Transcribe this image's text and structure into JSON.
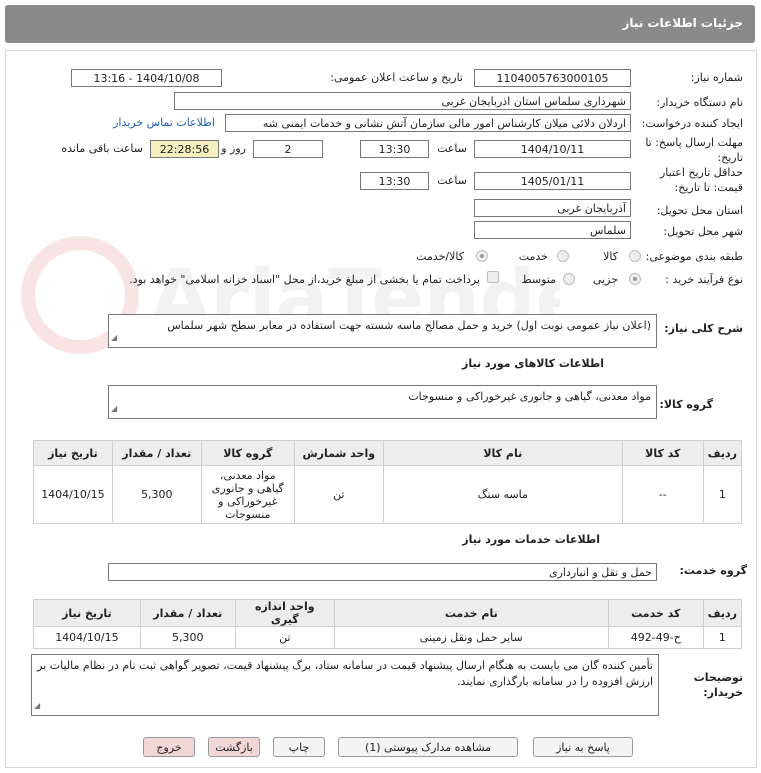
{
  "header": {
    "title": "جزئیات اطلاعات نیاز"
  },
  "watermark": {
    "text": "AriaTender.neT"
  },
  "form": {
    "need_number_label": "شماره نیاز:",
    "need_number": "1104005763000105",
    "announce_label": "تاریخ و ساعت اعلان عمومی:",
    "announce_value": "1404/10/08 - 13:16",
    "buyer_label": "نام دستگاه خریدار:",
    "buyer_value": "شهرداری سلماس استان اذربایجان غربی",
    "requester_label": "ایجاد کننده درخواست:",
    "requester_value": "اردلان دلائی میلان کارشناس امور مالی سازمان آتش نشانی و خدمات ایمنی شه",
    "contact_link": "اطلاعات تماس خریدار",
    "deadline_label_1": "مهلت ارسال پاسخ: تا",
    "deadline_label_2": "تاریخ:",
    "deadline_date": "1404/10/11",
    "time_label": "ساعت",
    "deadline_time": "13:30",
    "days_value": "2",
    "days_label": "روز و",
    "remaining_value": "22:28:56",
    "remaining_label": "ساعت باقی مانده",
    "validity_label_1": "حداقل تاریخ اعتبار",
    "validity_label_2": "قیمت: تا تاریخ:",
    "validity_date": "1405/01/11",
    "validity_time": "13:30",
    "province_label": "استان محل تحویل:",
    "province_value": "آذربایجان غربی",
    "city_label": "شهر محل تحویل:",
    "city_value": "سلماس",
    "category_label": "طبقه بندی موضوعی:",
    "category_options": [
      "کالا",
      "خدمت",
      "کالا/خدمت"
    ],
    "category_selected": "کالا/خدمت",
    "process_label": "نوع فرآیند خرید :",
    "process_options": [
      "جزیی",
      "متوسط"
    ],
    "process_selected": "جزیی",
    "payment_note": "پرداخت تمام یا بخشی از مبلغ خرید،از محل \"اسناد خزانه اسلامی\" خواهد بود."
  },
  "description": {
    "label": "شرح کلی نیاز:",
    "value": "(اعلان نیاز عمومی نوبت اول) خرید و حمل  مصالح ماسه شسته جهت استفاده در معابر سطح شهر سلماس"
  },
  "goods": {
    "section_title": "اطلاعات کالاهای مورد نیاز",
    "group_label": "گروه کالا:",
    "group_value": "مواد معدنی، گیاهی و جانوری غیرخوراکی و منسوجات",
    "columns": [
      "ردیف",
      "کد کالا",
      "نام کالا",
      "واحد شمارش",
      "گروه کالا",
      "تعداد / مقدار",
      "تاریخ نیاز"
    ],
    "rows": [
      {
        "row": "1",
        "code": "--",
        "name": "ماسه سنگ",
        "unit": "تن",
        "group": "مواد معدنی، گیاهی و جانوری غیرخوراکی و منسوجات",
        "qty": "5,300",
        "date": "1404/10/15"
      }
    ]
  },
  "services": {
    "section_title": "اطلاعات خدمات مورد نیاز",
    "group_label": "گروه خدمت:",
    "group_value": "حمل و نقل و انبارداری",
    "columns": [
      "ردیف",
      "کد خدمت",
      "نام خدمت",
      "واحد اندازه گیری",
      "تعداد / مقدار",
      "تاریخ نیاز"
    ],
    "rows": [
      {
        "row": "1",
        "code": "ح-49-492",
        "name": "سایر حمل ونقل زمینی",
        "unit": "تن",
        "qty": "5,300",
        "date": "1404/10/15"
      }
    ]
  },
  "notes": {
    "label_1": "توضیحات",
    "label_2": "خریدار:",
    "value": "تأمین کننده گان می بایست به هنگام ارسال پیشنهاد قیمت در سامانه ستاد، برگ پیشنهاد قیمت، تصویر گواهی ثبت نام در نظام مالیات بر ارزش افزوده را در سامانه بارگذاری نمایند."
  },
  "buttons": {
    "reply": "پاسخ به نیاز",
    "attachments": "مشاهده مدارک پیوستی (1)",
    "print": "چاپ",
    "back": "بازگشت",
    "exit": "خروج"
  },
  "colors": {
    "header": "#8a8a8a",
    "highlight": "#f6efbf",
    "link": "#1f5fb4"
  }
}
